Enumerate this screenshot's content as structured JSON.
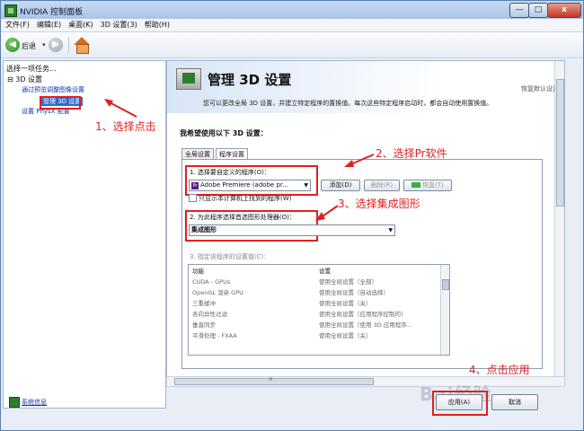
{
  "window": {
    "title": "NVIDIA 控制面板",
    "min": "—",
    "max": "□",
    "close": "x"
  },
  "menu": [
    "文件(F)",
    "编辑(E)",
    "桌面(K)",
    "3D 设置(3)",
    "帮助(H)"
  ],
  "toolbar": {
    "back_label": "后退",
    "dropdown": "▾"
  },
  "left": {
    "task_header": "选择一项任务...",
    "root": "⊟ 3D 设置",
    "items": [
      "通过预览调整图像设置",
      "管理 3D 设置",
      "设置 PhysX 配置"
    ],
    "sysinfo": "系统信息"
  },
  "main": {
    "title": "管理 3D 设置",
    "restore": "恢复默认设置",
    "description": "您可以更改全局 3D 设置，并建立特定程序的置换值。每次这些特定程序启动时，都会自动使用置换值。",
    "section": "我希望使用以下 3D 设置：",
    "tabs": [
      "全局设置",
      "程序设置"
    ],
    "step1": "1. 选择要自定义的程序(O)：",
    "program": "Adobe Premiere (adobe pr...",
    "add_btn": "添加(D)",
    "remove_btn": "删除(R)",
    "restore_btn": "恢复(T)",
    "only_show": "只显示本计算机上找到的程序(W)",
    "step2": "2. 为此程序选择首选图形处理器(O)：",
    "gpu": "集成图形",
    "step3": "3. 指定该程序的设置值(C)：",
    "table_headers": [
      "功能",
      "设置"
    ],
    "table_rows": [
      [
        "CUDA - GPUs",
        "使用全局设置（全部）"
      ],
      [
        "OpenGL 渲染 GPU",
        "使用全局设置（自动选择）"
      ],
      [
        "三重缓冲",
        "使用全局设置（关）"
      ],
      [
        "各向异性过滤",
        "使用全局设置（应用程序控制的）"
      ],
      [
        "垂直同步",
        "使用全局设置（使用 3D 应用程序..."
      ],
      [
        "平滑处理 - FXAA",
        "使用全局设置（关）"
      ]
    ],
    "hscroll_mark": "III"
  },
  "buttons": {
    "apply": "应用(A)",
    "cancel": "取消"
  },
  "annotations": [
    "1、选择点击",
    "2、选择Pr软件",
    "3、选择集成图形",
    "4、点击应用"
  ],
  "watermark": "Bai经验",
  "colors": {
    "annotation": "#e02020",
    "selection": "#2f6ad0",
    "link": "#1133aa"
  }
}
